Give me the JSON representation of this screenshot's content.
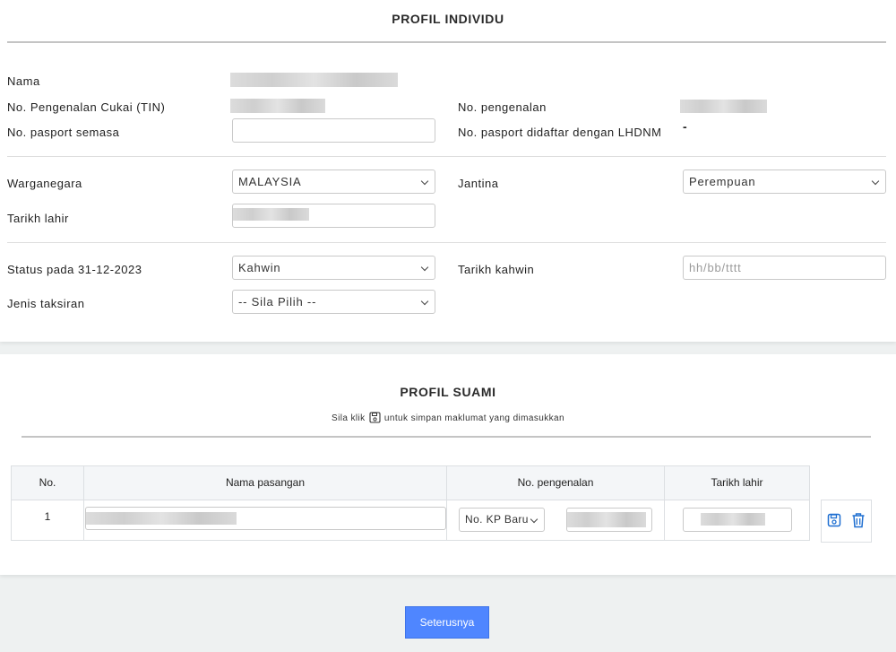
{
  "profil_individu": {
    "title": "PROFIL INDIVIDU",
    "nama_label": "Nama",
    "tin_label": "No. Pengenalan Cukai (TIN)",
    "pengenalan_label": "No. pengenalan",
    "pasport_semasa_label": "No. pasport semasa",
    "pasport_semasa_value": "",
    "pasport_lhdnm_label": "No. pasport didaftar dengan LHDNM",
    "pasport_lhdnm_value": "-",
    "warganegara_label": "Warganegara",
    "warganegara_value": "MALAYSIA",
    "jantina_label": "Jantina",
    "jantina_value": "Perempuan",
    "tarikh_lahir_label": "Tarikh lahir",
    "status_label": "Status pada 31-12-2023",
    "status_value": "Kahwin",
    "tarikh_kahwin_label": "Tarikh kahwin",
    "tarikh_kahwin_placeholder": "hh/bb/tttt",
    "jenis_taksiran_label": "Jenis taksiran",
    "jenis_taksiran_value": "-- Sila Pilih --"
  },
  "profil_suami": {
    "title": "PROFIL SUAMI",
    "hint_before": "Sila klik",
    "hint_after": "untuk simpan maklumat yang dimasukkan",
    "table": {
      "headers": [
        "No.",
        "Nama pasangan",
        "No. pengenalan",
        "Tarikh lahir"
      ],
      "rows": [
        {
          "no": "1",
          "jenis_pengenalan": "No. KP Baru"
        }
      ]
    }
  },
  "footer": {
    "next_label": "Seterusnya"
  },
  "colors": {
    "accent": "#4f86ff",
    "icon_blue": "#1f6fd1"
  }
}
